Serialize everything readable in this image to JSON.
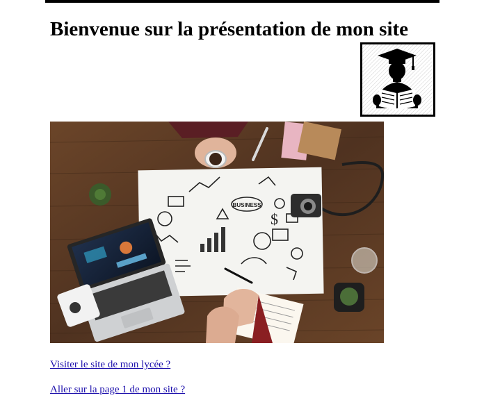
{
  "page": {
    "title": "Bienvenue sur la présentation de mon site"
  },
  "logo": {
    "icon": "student-reading-graduate-icon"
  },
  "hero": {
    "icon": "business-workspace-photo",
    "sketch_label": "BUSINESS"
  },
  "links": [
    {
      "label": "Visiter le site de mon lycée ?"
    },
    {
      "label": "Aller sur la page 1 de mon site ?"
    }
  ],
  "colors": {
    "link": "#1a0dab",
    "rule": "#000000",
    "table_wood": "#5b3a24"
  }
}
